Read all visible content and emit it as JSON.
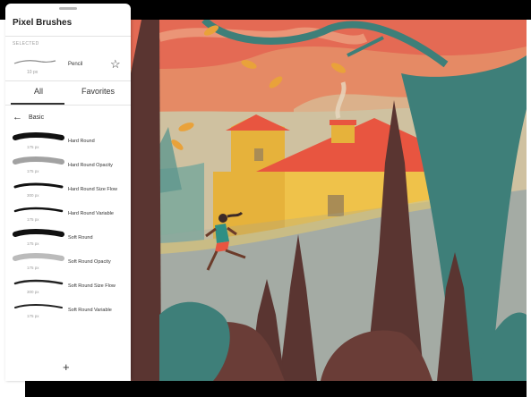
{
  "panel": {
    "title": "Pixel Brushes",
    "selected_label": "SELECTED",
    "selected_brush": {
      "name": "Pencil",
      "size": "10 px"
    },
    "tabs": [
      {
        "label": "All",
        "active": true
      },
      {
        "label": "Favorites",
        "active": false
      }
    ],
    "category": "Basic",
    "brushes": [
      {
        "name": "Hard Round",
        "size": "175 px"
      },
      {
        "name": "Hard Round Opacity",
        "size": "175 px"
      },
      {
        "name": "Hard Round Size Flow",
        "size": "300 px"
      },
      {
        "name": "Hard Round Variable",
        "size": "175 px"
      },
      {
        "name": "Soft Round",
        "size": "175 px"
      },
      {
        "name": "Soft Round Opacity",
        "size": "175 px"
      },
      {
        "name": "Soft Round Size Flow",
        "size": "300 px"
      },
      {
        "name": "Soft Round Variable",
        "size": "175 px"
      }
    ],
    "add_label": "+"
  },
  "colors": {
    "sky": "#e46a54",
    "house_wall": "#e6b23b",
    "roof": "#e85540",
    "tree_dark": "#5a3531",
    "tree_teal": "#3e7f79",
    "ground_grey": "#a7aea6"
  },
  "icons": {
    "star": "☆",
    "back": "←"
  }
}
